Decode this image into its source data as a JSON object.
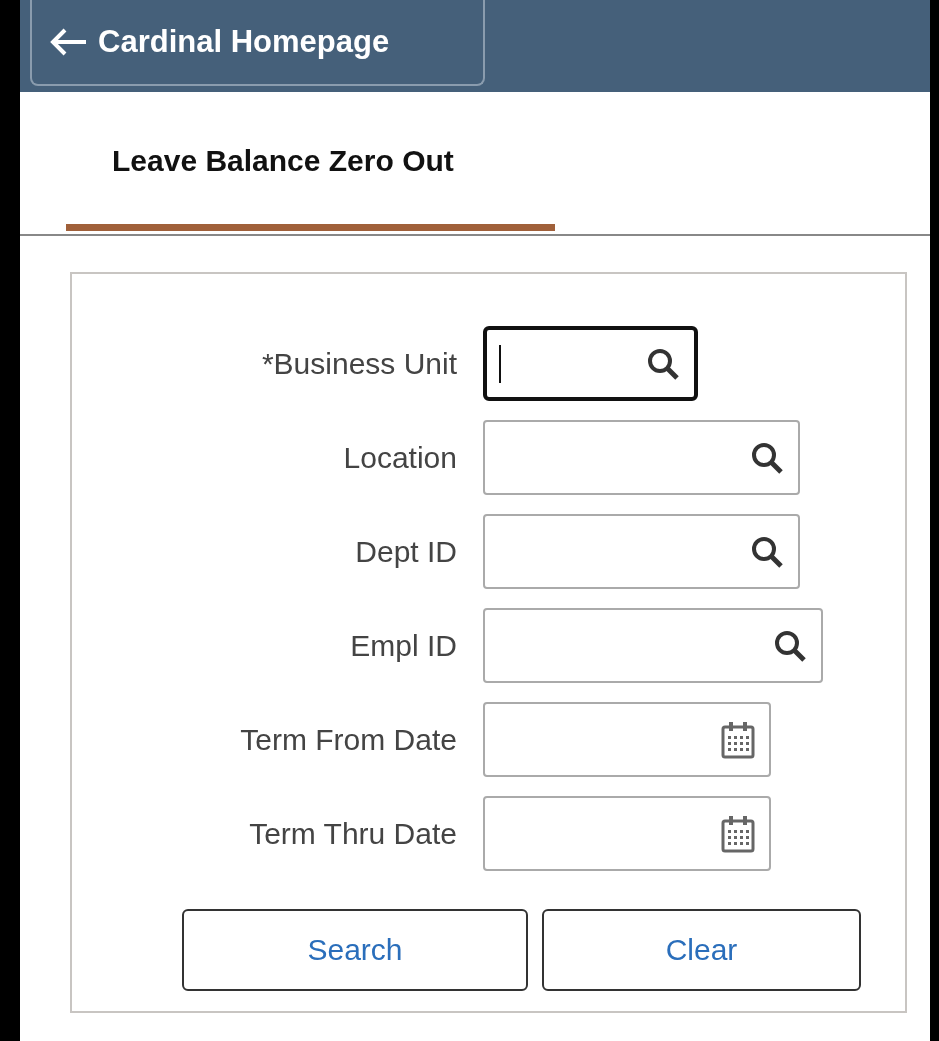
{
  "header": {
    "back_button": {
      "label": "Cardinal Homepage"
    }
  },
  "tabs": [
    {
      "label": "Leave Balance Zero Out",
      "selected": true
    }
  ],
  "fields": [
    {
      "label": "*Business Unit",
      "kind": "lookup",
      "focused": true
    },
    {
      "label": "Location",
      "kind": "lookup",
      "focused": false
    },
    {
      "label": "Dept ID",
      "kind": "lookup",
      "focused": false
    },
    {
      "label": "Empl ID",
      "kind": "lookup",
      "focused": false
    },
    {
      "label": "Term From Date",
      "kind": "date",
      "focused": false
    },
    {
      "label": "Term Thru Date",
      "kind": "date",
      "focused": false
    }
  ],
  "buttons": [
    {
      "label": "Search"
    },
    {
      "label": "Clear"
    }
  ]
}
